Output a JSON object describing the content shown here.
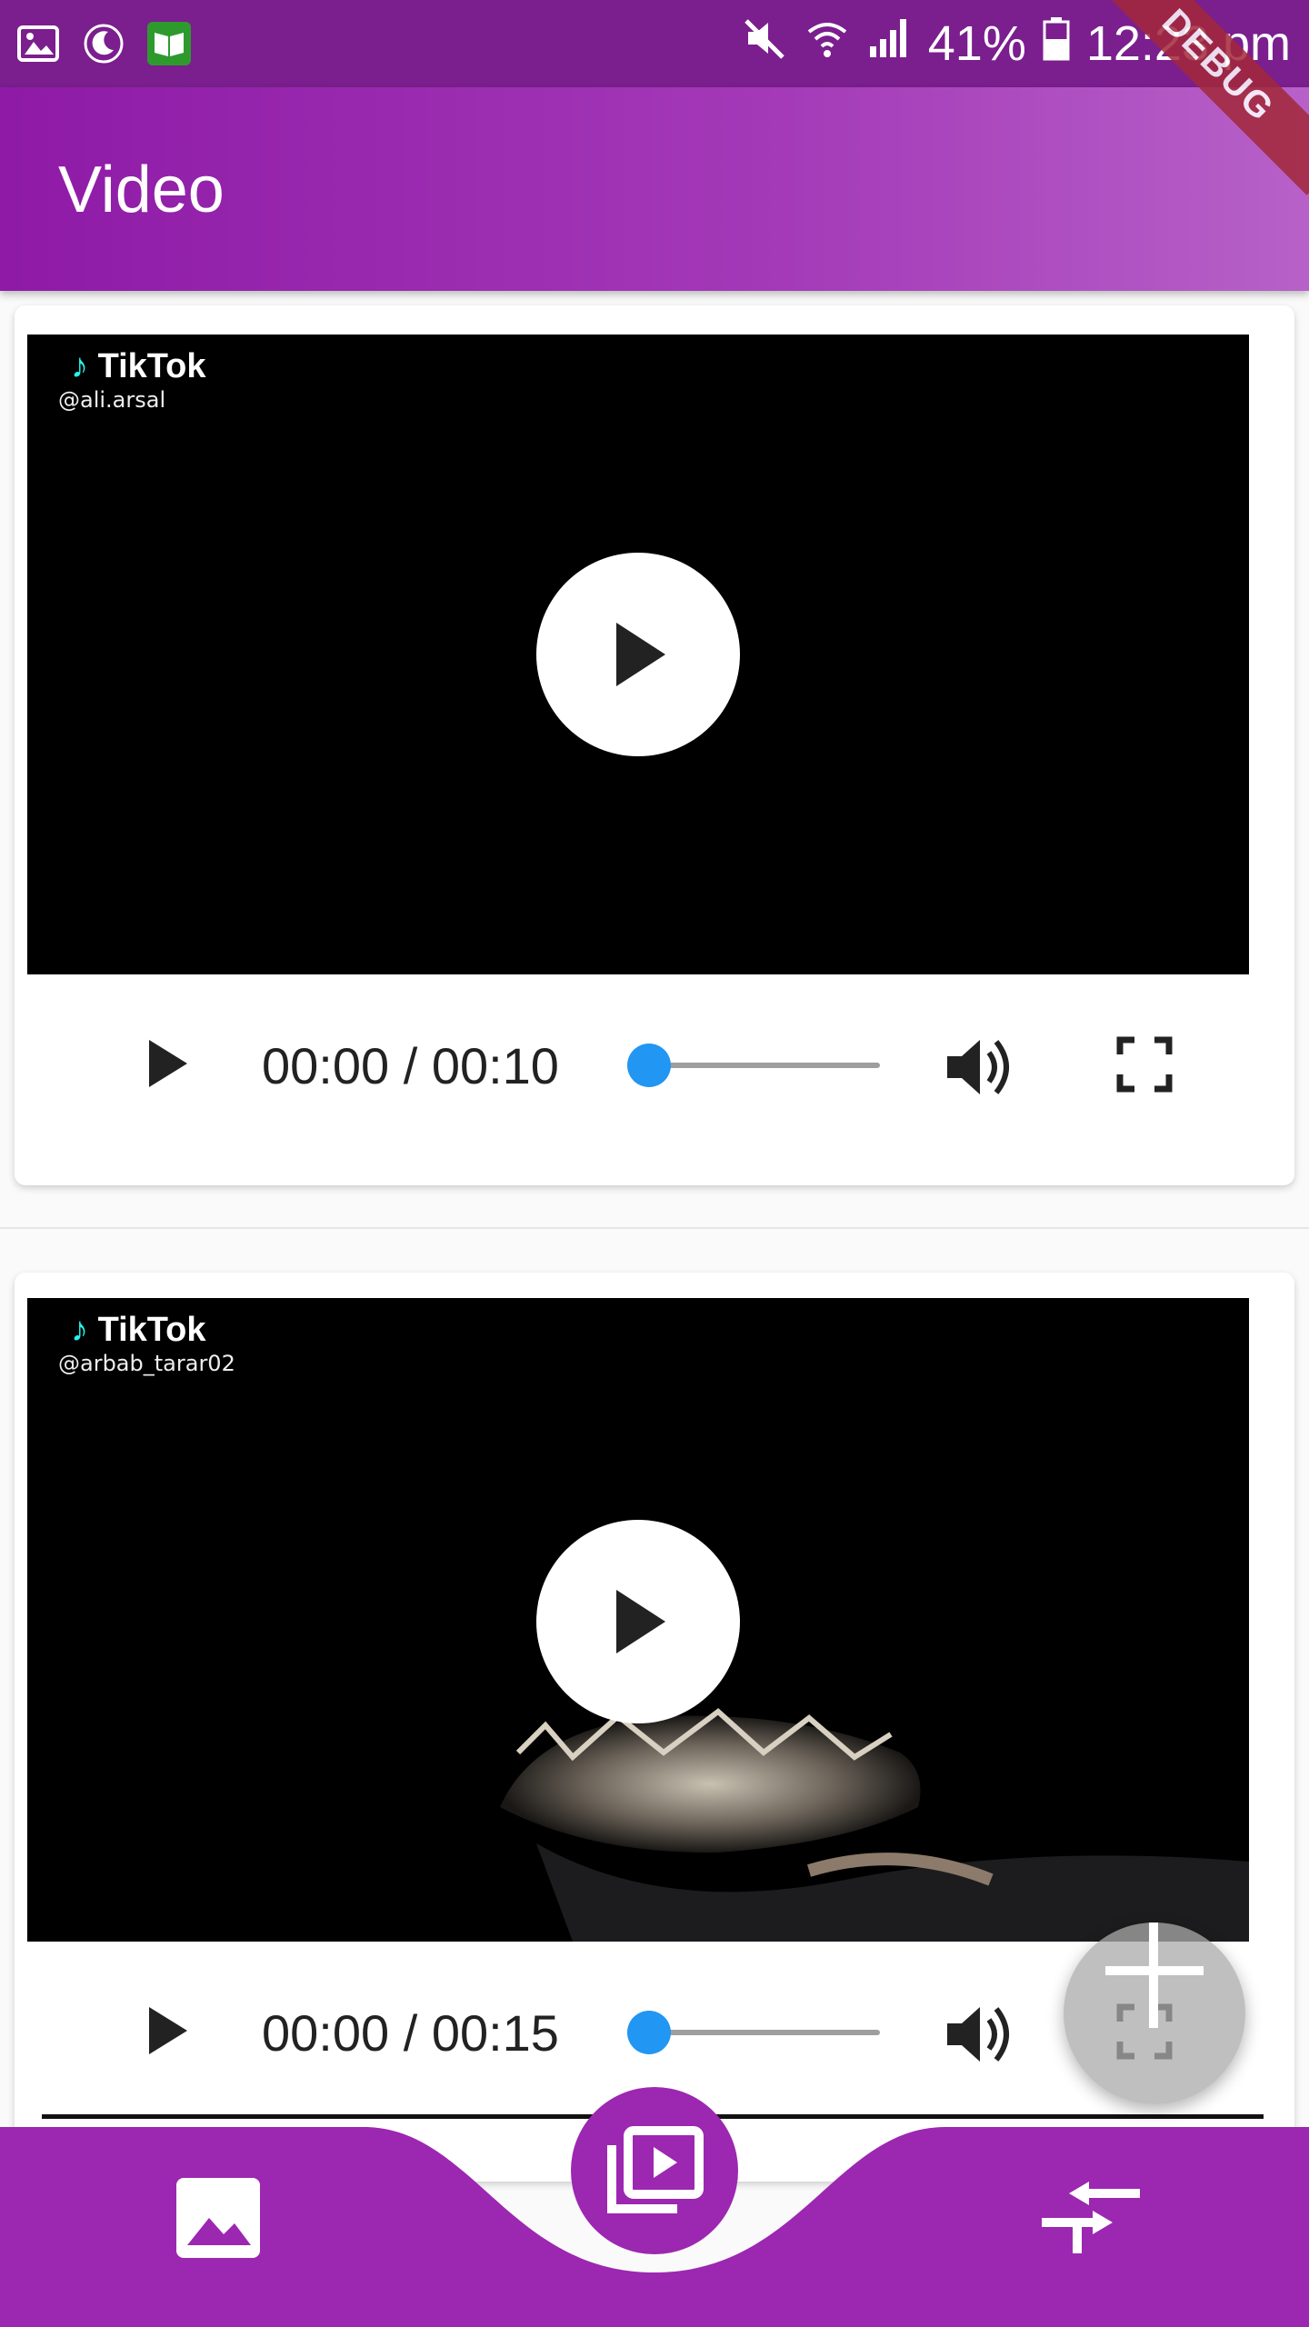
{
  "status_bar": {
    "battery": "41%",
    "time": "12:23 pm",
    "icons": [
      "gallery-icon",
      "moon-icon",
      "book-icon",
      "mute-icon",
      "wifi-icon",
      "signal-icon",
      "battery-icon"
    ]
  },
  "app_bar": {
    "title": "Video",
    "debug_banner": "DEBUG"
  },
  "videos": [
    {
      "brand": "TikTok",
      "user": "@ali.arsal",
      "time": "00:00 / 00:10",
      "progress": 0
    },
    {
      "brand": "TikTok",
      "user": "@arbab_tarar02",
      "time": "00:00 / 00:15",
      "progress": 0
    }
  ],
  "fab": {
    "icon": "add-icon"
  },
  "bottom_nav": {
    "items": [
      {
        "icon": "image-icon"
      },
      {
        "icon": "video-library-icon",
        "active": true
      },
      {
        "icon": "compress-icon"
      }
    ]
  },
  "colors": {
    "primary": "#9c27b0",
    "status_bar": "#7b1e8e",
    "accent": "#2196f3"
  }
}
